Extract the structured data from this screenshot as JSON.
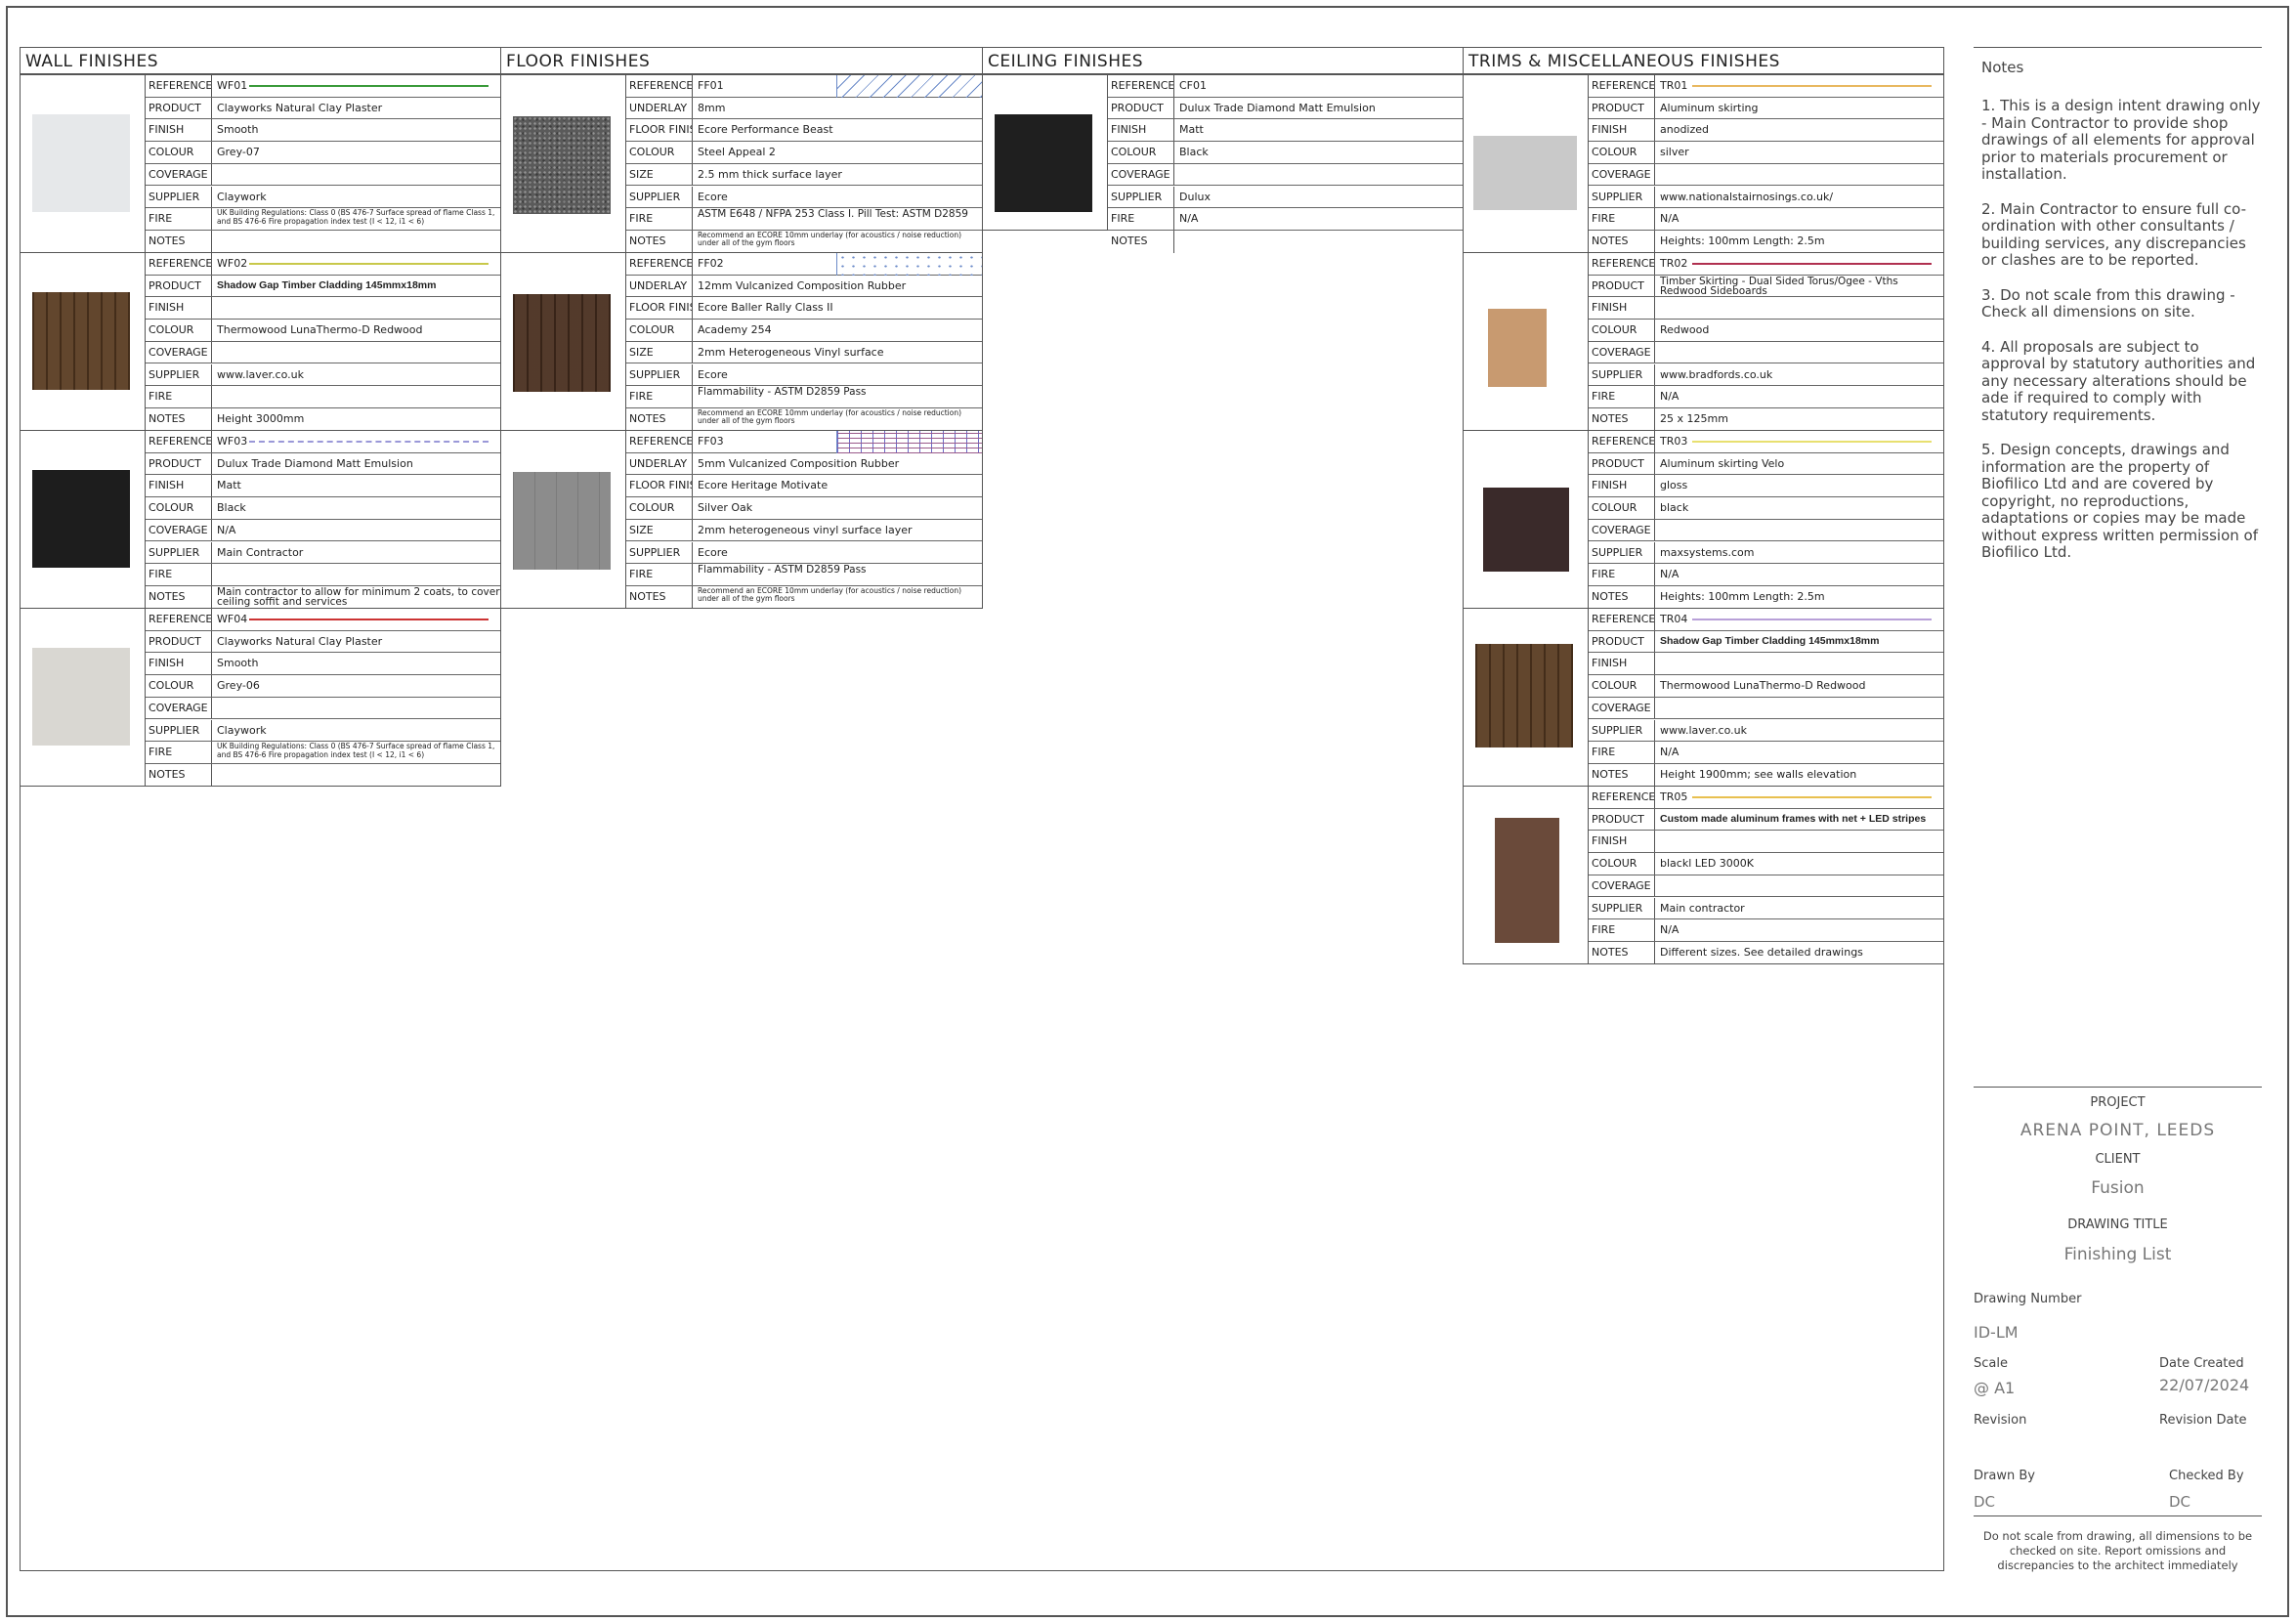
{
  "sections": {
    "wall": "WALL FINISHES",
    "floor": "FLOOR FINISHES",
    "ceiling": "CEILING FINISHES",
    "trims": "TRIMS & MISCELLANEOUS FINISHES"
  },
  "labels": {
    "reference": "REFERENCE",
    "product": "PRODUCT",
    "finish": "FINISH",
    "colour": "COLOUR",
    "coverage": "COVERAGE",
    "supplier": "SUPPLIER",
    "fire": "FIRE",
    "notes": "NOTES",
    "underlay": "UNDERLAY",
    "floor_finish": "FLOOR FINISH",
    "size": "SIZE"
  },
  "wall": [
    {
      "reference": "WF01",
      "line_color": "#3a9a3a",
      "line_style": "solid",
      "swatch": "#e6e8ea",
      "product": "Clayworks Natural Clay Plaster",
      "finish": "Smooth",
      "colour": "Grey-07",
      "coverage": "",
      "supplier": "Claywork",
      "fire": "UK Building Regulations: Class 0 (BS 476-7 Surface spread of flame Class 1, and BS 476-6 Fire propagation index test (I < 12, i1 < 6)",
      "notes": ""
    },
    {
      "reference": "WF02",
      "line_color": "#c8c84a",
      "line_style": "solid",
      "swatch": "#5a3c22",
      "product": "Shadow Gap Timber Cladding 145mmx18mm",
      "finish": "",
      "colour": "Thermowood LunaThermo-D Redwood",
      "coverage": "",
      "supplier": "www.laver.co.uk",
      "fire": "",
      "notes": "Height 3000mm"
    },
    {
      "reference": "WF03",
      "line_color": "#9a98d8",
      "line_style": "dashed",
      "swatch": "#1d1d1d",
      "product": "Dulux Trade Diamond Matt Emulsion",
      "finish": "Matt",
      "colour": "Black",
      "coverage": "N/A",
      "supplier": "Main Contractor",
      "fire": "",
      "notes": "Main contractor to allow for minimum 2 coats, to cover ceiling soffit and services"
    },
    {
      "reference": "WF04",
      "line_color": "#cc3333",
      "line_style": "solid",
      "swatch": "#d9d7d2",
      "product": "Clayworks Natural Clay Plaster",
      "finish": "Smooth",
      "colour": "Grey-06",
      "coverage": "",
      "supplier": "Claywork",
      "fire": "UK Building Regulations: Class 0 (BS 476-7 Surface spread of flame Class 1, and BS 476-6 Fire propagation index test (I < 12, i1 < 6)",
      "notes": ""
    }
  ],
  "floor": [
    {
      "reference": "FF01",
      "underlay": "8mm",
      "floor_finish": "Ecore Performance Beast",
      "colour": "Steel Appeal 2",
      "size": "2.5 mm thick surface layer",
      "supplier": "Ecore",
      "fire": "ASTM E648 / NFPA 253 Class I. Pill Test: ASTM D2859",
      "notes": "Recommend an ECORE 10mm underlay (for acoustics / noise reduction) under all of the gym floors",
      "swatch": "#5a5a5a",
      "hatch": "diagonal"
    },
    {
      "reference": "FF02",
      "underlay": "12mm Vulcanized Composition Rubber",
      "floor_finish": "Ecore Baller Rally Class II",
      "colour": "Academy 254",
      "size": "2mm Heterogeneous Vinyl surface",
      "supplier": "Ecore",
      "fire": "Flammability - ASTM D2859 Pass",
      "notes": "Recommend an ECORE 10mm underlay (for acoustics / noise reduction) under all of the gym floors",
      "swatch": "#4a3020",
      "hatch": "dots"
    },
    {
      "reference": "FF03",
      "underlay": "5mm Vulcanized Composition Rubber",
      "floor_finish": "Ecore Heritage Motivate",
      "colour": "Silver Oak",
      "size": "2mm heterogeneous vinyl surface layer",
      "supplier": "Ecore",
      "fire": "Flammability - ASTM D2859 Pass",
      "notes": "Recommend an ECORE 10mm underlay (for acoustics / noise reduction) under all of the gym floors",
      "swatch": "#8c8c8c",
      "hatch": "brick"
    }
  ],
  "ceiling": [
    {
      "reference": "CF01",
      "product": "Dulux Trade Diamond Matt Emulsion",
      "finish": "Matt",
      "colour": "Black",
      "coverage": "",
      "supplier": "Dulux",
      "fire": "N/A",
      "notes": "",
      "swatch": "#1f1f1f"
    }
  ],
  "trims": [
    {
      "reference": "TR01",
      "line_color": "#e8b860",
      "product": "Aluminum skirting",
      "finish": "anodized",
      "colour": "silver",
      "coverage": "",
      "supplier": "www.nationalstairnosings.co.uk/",
      "fire": "N/A",
      "notes": "Heights: 100mm Length: 2.5m",
      "swatch": "#c9c9c9"
    },
    {
      "reference": "TR02",
      "line_color": "#b03050",
      "product": "Timber Skirting - Dual Sided Torus/Ogee - Vths Redwood Sideboards",
      "finish": "",
      "colour": "Redwood",
      "coverage": "",
      "supplier": "www.bradfords.co.uk",
      "fire": "N/A",
      "notes": "25 x 125mm",
      "swatch": "#c89a70"
    },
    {
      "reference": "TR03",
      "line_color": "#e8e070",
      "product": "Aluminum skirting Velo",
      "finish": "gloss",
      "colour": "black",
      "coverage": "",
      "supplier": "maxsystems.com",
      "fire": "N/A",
      "notes": "Heights: 100mm Length: 2.5m",
      "swatch": "#3a2a2a"
    },
    {
      "reference": "TR04",
      "line_color": "#b8a0d8",
      "product": "Shadow Gap Timber Cladding 145mmx18mm",
      "finish": "",
      "colour": "Thermowood LunaThermo-D Redwood",
      "coverage": "",
      "supplier": "www.laver.co.uk",
      "fire": "N/A",
      "notes": "Height 1900mm; see walls elevation",
      "swatch": "#5a3c22"
    },
    {
      "reference": "TR05",
      "line_color": "#e8c050",
      "product": "Custom made aluminum frames with net + LED stripes",
      "finish": "",
      "colour": "blackl LED 3000K",
      "coverage": "",
      "supplier": "Main contractor",
      "fire": "N/A",
      "notes": "Different sizes. See detailed drawings",
      "swatch": "#6a4a3a"
    }
  ],
  "notes": {
    "title": "Notes",
    "items": [
      "1. This is a design intent drawing only - Main Contractor to provide shop drawings of all elements for approval prior to materials procurement or installation.",
      "2. Main Contractor to ensure full co-ordination with other consultants / building services, any discrepancies or clashes are to be reported.",
      "3. Do not scale from this drawing - Check all dimensions on site.",
      "4. All proposals are subject to approval by statutory authorities and any necessary alterations should be ade if required to comply with statutory requirements.",
      "5. Design concepts, drawings and information are the property of Biofilico Ltd and are covered by copyright, no reproductions, adaptations or copies may be made without express written permission of Biofilico Ltd."
    ]
  },
  "title_block": {
    "project_label": "PROJECT",
    "project": "ARENA POINT, LEEDS",
    "client_label": "CLIENT",
    "client": "Fusion",
    "drawing_title_label": "DRAWING TITLE",
    "drawing_title": "Finishing List",
    "drawing_number_label": "Drawing Number",
    "drawing_number": "ID-LM",
    "scale_label": "Scale",
    "scale": "@ A1",
    "date_created_label": "Date Created",
    "date_created": "22/07/2024",
    "revision_label": "Revision",
    "revision_date_label": "Revision Date",
    "drawn_by_label": "Drawn By",
    "drawn_by": "DC",
    "checked_by_label": "Checked By",
    "checked_by": "DC",
    "disclaimer": "Do not scale from drawing, all dimensions to be checked on site. Report omissions and discrepancies to the architect immediately"
  }
}
